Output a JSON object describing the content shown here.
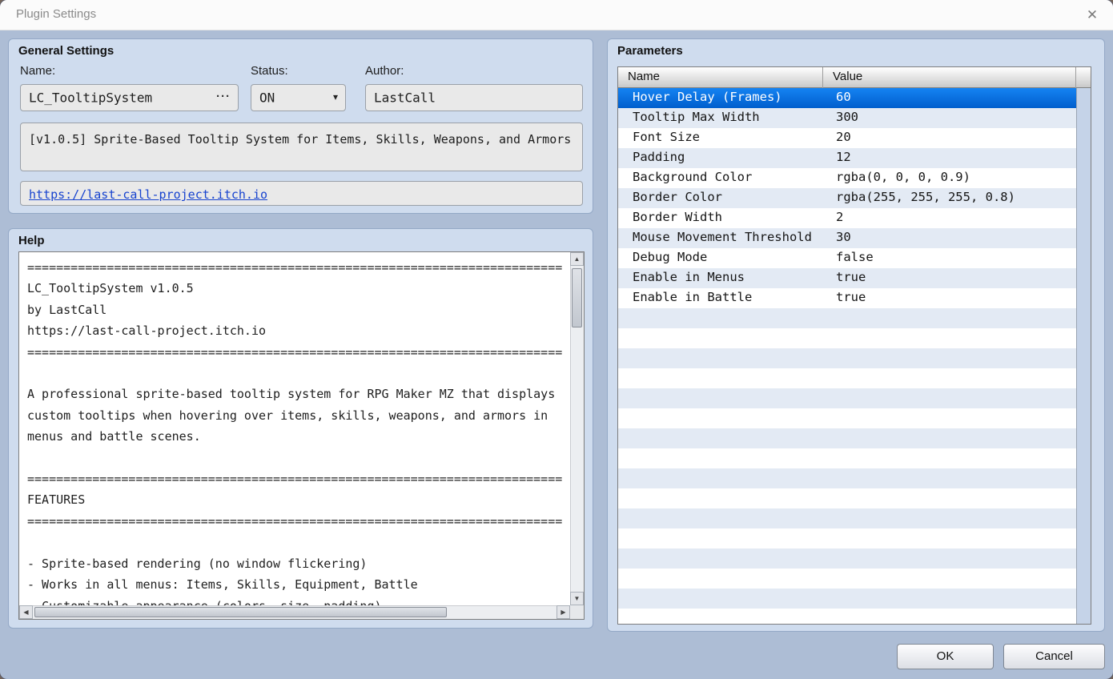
{
  "window": {
    "title": "Plugin Settings",
    "close_glyph": "✕"
  },
  "general": {
    "title": "General Settings",
    "name_label": "Name:",
    "name_value": "LC_TooltipSystem",
    "more_glyph": "···",
    "status_label": "Status:",
    "status_value": "ON",
    "dropdown_glyph": "▼",
    "author_label": "Author:",
    "author_value": "LastCall",
    "description": "[v1.0.5] Sprite-Based Tooltip System for Items, Skills, Weapons, and Armors",
    "link": "https://last-call-project.itch.io"
  },
  "help": {
    "title": "Help",
    "lines": [
      "==========================================================================",
      "LC_TooltipSystem v1.0.5",
      "by LastCall",
      "https://last-call-project.itch.io",
      "==========================================================================",
      "",
      "A professional sprite-based tooltip system for RPG Maker MZ that displays",
      "custom tooltips when hovering over items, skills, weapons, and armors in",
      "menus and battle scenes.",
      "",
      "==========================================================================",
      "FEATURES",
      "==========================================================================",
      "",
      "- Sprite-based rendering (no window flickering)",
      "- Works in all menus: Items, Skills, Equipment, Battle",
      "- Customizable appearance (colors, size, padding)"
    ],
    "scroll_up_glyph": "▲",
    "scroll_down_glyph": "▼",
    "scroll_left_glyph": "◀",
    "scroll_right_glyph": "▶"
  },
  "parameters": {
    "title": "Parameters",
    "columns": {
      "name": "Name",
      "value": "Value"
    },
    "rows": [
      {
        "name": "Hover Delay (Frames)",
        "value": "60",
        "selected": true
      },
      {
        "name": "Tooltip Max Width",
        "value": "300"
      },
      {
        "name": "Font Size",
        "value": "20"
      },
      {
        "name": "Padding",
        "value": "12"
      },
      {
        "name": "Background Color",
        "value": "rgba(0, 0, 0, 0.9)"
      },
      {
        "name": "Border Color",
        "value": "rgba(255, 255, 255, 0.8)"
      },
      {
        "name": "Border Width",
        "value": "2"
      },
      {
        "name": "Mouse Movement Threshold",
        "value": "30"
      },
      {
        "name": "Debug Mode",
        "value": "false"
      },
      {
        "name": "Enable in Menus",
        "value": "true"
      },
      {
        "name": "Enable in Battle",
        "value": "true"
      }
    ]
  },
  "footer": {
    "ok": "OK",
    "cancel": "Cancel"
  },
  "colors": {
    "body_bg": "#adbdd5",
    "panel_bg": "#cfdcee",
    "stripe": "#e3eaf4",
    "selection": "#0c6fdd",
    "link": "#1743cf"
  }
}
